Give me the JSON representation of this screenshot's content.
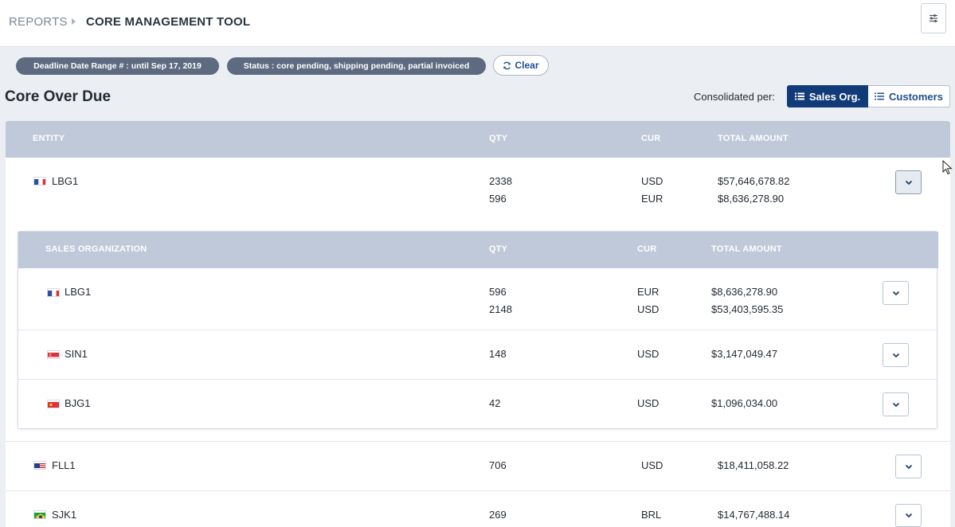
{
  "breadcrumb": {
    "root": "REPORTS",
    "current": "CORE MANAGEMENT TOOL"
  },
  "filters": {
    "deadline": "Deadline Date Range # : until Sep 17, 2019",
    "status": "Status : core pending, shipping pending, partial invoiced",
    "clear_label": "Clear"
  },
  "page_title": "Core Over Due",
  "consolidation": {
    "label": "Consolidated per:",
    "sales_org": "Sales Org.",
    "customers": "Customers",
    "selected": "Sales Org."
  },
  "table": {
    "headers": {
      "entity": "ENTITY",
      "qty": "QTY",
      "cur": "CUR",
      "total": "TOTAL AMOUNT"
    },
    "rows": [
      {
        "entity": "LBG1",
        "flag": "france",
        "lines": [
          {
            "qty": "2338",
            "cur": "USD",
            "total": "$57,646,678.82"
          },
          {
            "qty": "596",
            "cur": "EUR",
            "total": "$8,636,278.90"
          }
        ],
        "expanded": true
      },
      {
        "entity": "FLL1",
        "flag": "usa",
        "lines": [
          {
            "qty": "706",
            "cur": "USD",
            "total": "$18,411,058.22"
          }
        ],
        "expanded": false
      },
      {
        "entity": "SJK1",
        "flag": "brazil",
        "lines": [
          {
            "qty": "269",
            "cur": "BRL",
            "total": "$14,767,488.14"
          }
        ],
        "expanded": false
      }
    ]
  },
  "sub_table": {
    "headers": {
      "org": "SALES ORGANIZATION",
      "qty": "QTY",
      "cur": "CUR",
      "total": "TOTAL AMOUNT"
    },
    "rows": [
      {
        "org": "LBG1",
        "flag": "france",
        "lines": [
          {
            "qty": "596",
            "cur": "EUR",
            "total": "$8,636,278.90"
          },
          {
            "qty": "2148",
            "cur": "USD",
            "total": "$53,403,595.35"
          }
        ]
      },
      {
        "org": "SIN1",
        "flag": "singapore",
        "lines": [
          {
            "qty": "148",
            "cur": "USD",
            "total": "$3,147,049.47"
          }
        ]
      },
      {
        "org": "BJG1",
        "flag": "china",
        "lines": [
          {
            "qty": "42",
            "cur": "USD",
            "total": "$1,096,034.00"
          }
        ]
      }
    ]
  },
  "colors": {
    "primary": "#113a78",
    "header_bg": "#bfc9d9",
    "chip_bg": "#5d6a80",
    "page_bg": "#ebeff4"
  }
}
